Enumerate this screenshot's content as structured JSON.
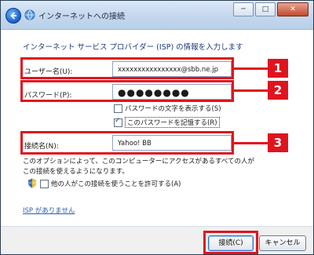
{
  "window": {
    "title": "インターネットへの接続",
    "minimize_glyph": "─",
    "maximize_glyph": "□",
    "close_glyph": "✕"
  },
  "form": {
    "heading": "インターネット サービス プロバイダー (ISP) の情報を入力します",
    "username_label": "ユーザー名(U):",
    "username_value": "xxxxxxxxxxxxxxxx@sbb.ne.jp",
    "password_label": "パスワード(P):",
    "password_value": "●●●●●●●●",
    "show_chars_label": "パスワードの文字を表示する(S)",
    "show_chars_checked": false,
    "remember_label": "このパスワードを記憶する(R)",
    "remember_checked": true,
    "connection_name_label": "接続名(N):",
    "connection_name_value": "Yahoo! BB",
    "note": "このオプションによって、このコンピューターにアクセスがあるすべての人がこの接続を使えるようになります。",
    "allow_others_label": "他の人がこの接続を使うことを許可する(A)",
    "allow_others_checked": false,
    "no_isp_link": "ISP がありません"
  },
  "buttons": {
    "connect": "接続(C)",
    "cancel": "キャンセル"
  },
  "annotations": {
    "badge_1": "1",
    "badge_2": "2",
    "badge_3": "3",
    "highlight_color": "#e0141e"
  }
}
